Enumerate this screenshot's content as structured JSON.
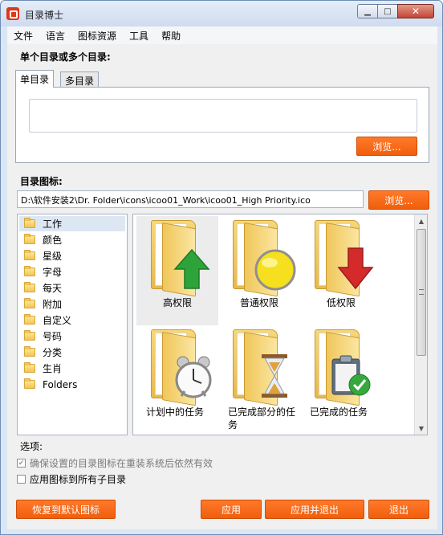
{
  "window": {
    "title": "目录博士"
  },
  "titlebar_buttons": {
    "minimize": "▁",
    "maximize": "□",
    "close": "✕"
  },
  "menu": [
    "文件",
    "语言",
    "图标资源",
    "工具",
    "帮助"
  ],
  "single_or_multi": {
    "label": "单个目录或多个目录:",
    "tabs": [
      "单目录",
      "多目录"
    ],
    "browse_label": "浏览..."
  },
  "icon_section": {
    "label": "目录图标:",
    "path": "D:\\软件安装2\\Dr. Folder\\icons\\icoo01_Work\\icoo01_High Priority.ico",
    "browse_label": "浏览..."
  },
  "tree": {
    "items": [
      "工作",
      "颜色",
      "星级",
      "字母",
      "每天",
      "附加",
      "自定义",
      "号码",
      "分类",
      "生肖",
      "Folders"
    ],
    "selected": 0
  },
  "icons": [
    {
      "label": "高权限",
      "icon": "green-up-arrow-folder",
      "selected": true
    },
    {
      "label": "普通权限",
      "icon": "yellow-circle-folder",
      "selected": false
    },
    {
      "label": "低权限",
      "icon": "red-down-arrow-folder",
      "selected": false
    },
    {
      "label": "计划中的任务",
      "icon": "alarm-clock-folder",
      "selected": false
    },
    {
      "label": "已完成部分的任务",
      "icon": "hourglass-folder",
      "selected": false
    },
    {
      "label": "已完成的任务",
      "icon": "clipboard-check-folder",
      "selected": false
    }
  ],
  "options": {
    "label": "选项:",
    "keep_after_reinstall": {
      "label": "确保设置的目录图标在重装系统后依然有效",
      "checked": true,
      "disabled": true
    },
    "apply_subfolders": {
      "label": "应用图标到所有子目录",
      "checked": false
    }
  },
  "footer": {
    "restore": "恢复到默认图标",
    "apply": "应用",
    "apply_exit": "应用并退出",
    "exit": "退出"
  },
  "colors": {
    "accent": "#f26a1b",
    "selection": "#dde7f4"
  }
}
